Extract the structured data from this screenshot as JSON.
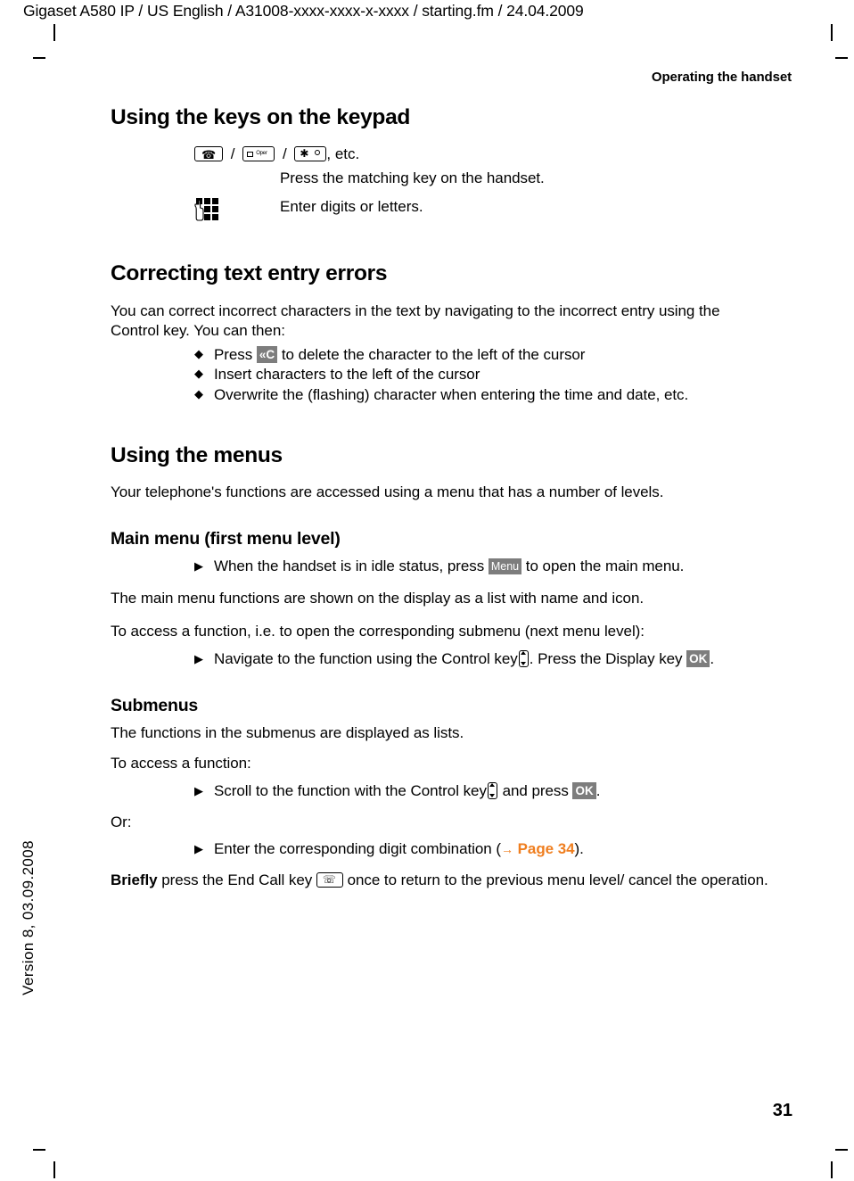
{
  "header": {
    "file_line": "Gigaset A580 IP / US English / A31008-xxxx-xxxx-x-xxxx / starting.fm / 24.04.2009",
    "running_head": "Operating the handset"
  },
  "footer": {
    "version": "Version 8, 03.09.2008",
    "page_number": "31"
  },
  "colors": {
    "link_orange": "#ef7e1f",
    "badge_gray": "#7d7d7d",
    "text": "#000000",
    "background": "#ffffff"
  },
  "sections": {
    "keypad": {
      "heading": "Using the keys on the keypad",
      "key_row": {
        "sep1": "/",
        "sep2": "/",
        "trailing": ", etc.",
        "msg_key_label": "Oper",
        "description": "Press the matching key on the handset."
      },
      "digits_row": {
        "description": "Enter digits or letters."
      }
    },
    "correcting": {
      "heading": "Correcting text entry errors",
      "intro": "You can correct incorrect characters in the text by navigating to the incorrect entry using the Control key. You can then:",
      "bullets": [
        {
          "before": "Press ",
          "badge": "«C",
          "after": " to delete the character to the left of the cursor"
        },
        {
          "before": "Insert characters to the left of the cursor",
          "badge": "",
          "after": ""
        },
        {
          "before": "Overwrite the (flashing) character when entering the time and date, etc.",
          "badge": "",
          "after": ""
        }
      ]
    },
    "menus": {
      "heading": "Using the menus",
      "intro": "Your telephone's functions are accessed using a menu that has a number of levels.",
      "main_menu": {
        "heading": "Main menu (first menu level)",
        "step_before": "When the handset is in idle status, press ",
        "step_badge": "Menu",
        "step_after": " to open the main menu.",
        "para1": "The main menu functions are shown on the display as a list with name and icon.",
        "para2": "To access a function, i.e. to open the corresponding submenu (next menu level):",
        "step2_before": "Navigate to the function using the Control key",
        "step2_mid": ". Press the Display key ",
        "step2_badge": "OK",
        "step2_after": "."
      },
      "submenus": {
        "heading": "Submenus",
        "para1": "The functions in the submenus are displayed as lists.",
        "para2": "To access a function:",
        "step1_before": "Scroll to the function with the Control key",
        "step1_mid": " and press ",
        "step1_badge": "OK",
        "step1_after": ".",
        "or_label": "Or:",
        "step2_before": "Enter the corresponding digit combination (",
        "step2_arrow": "→",
        "step2_link": "Page 34",
        "step2_after": ").",
        "closing_bold": "Briefly",
        "closing_before": " press the End Call key ",
        "closing_after": " once to return to the previous menu level/ cancel the operation."
      }
    }
  },
  "icons": {
    "talk_key": "talk-key-icon",
    "message_key": "message-key-icon",
    "star_key": "star-key-icon",
    "keypad": "keypad-digits-icon",
    "control_key": "control-key-icon",
    "end_call_key": "end-call-key-icon",
    "bullet_diamond": "◆",
    "arrow_triangle": "▶"
  }
}
